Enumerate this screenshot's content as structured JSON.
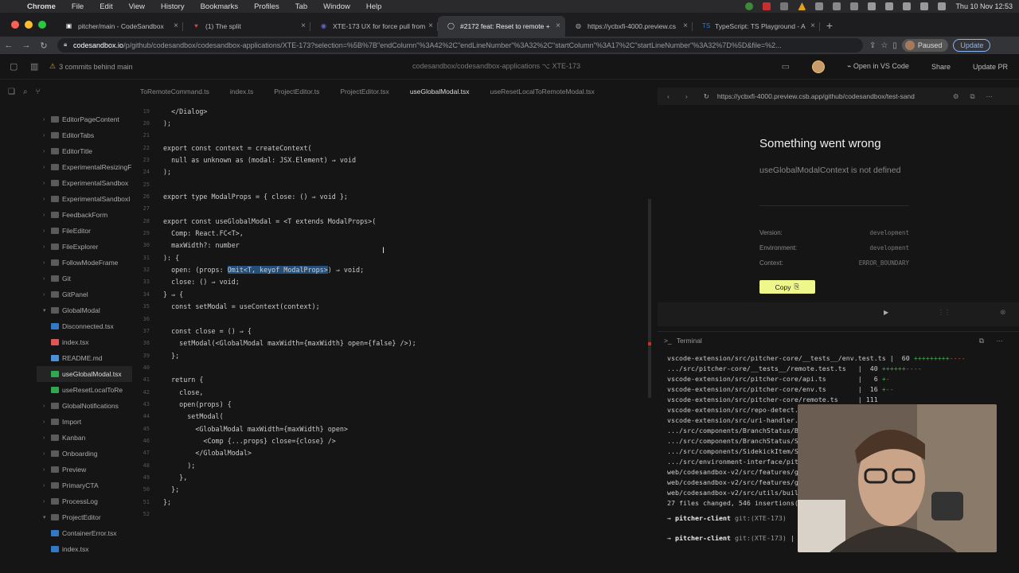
{
  "menubar": {
    "app": "Chrome",
    "items": [
      "File",
      "Edit",
      "View",
      "History",
      "Bookmarks",
      "Profiles",
      "Tab",
      "Window",
      "Help"
    ],
    "clock": "Thu 10 Nov  12:53"
  },
  "tabs": [
    {
      "label": "pitcher/main - CodeSandbox",
      "fav": "▣",
      "fav_color": "#ffffff"
    },
    {
      "label": "(1) The split",
      "fav": "♥",
      "fav_color": "#e04040"
    },
    {
      "label": "XTE-173 UX for force pull from",
      "fav": "◉",
      "fav_color": "#5e6ad2"
    },
    {
      "label": "#2172 feat: Reset to remote +",
      "fav": "◯",
      "fav_color": "#dddddd",
      "active": true
    },
    {
      "label": "https://ycbxfi-4000.preview.cs",
      "fav": "◍",
      "fav_color": "#aaaaaa"
    },
    {
      "label": "TypeScript: TS Playground - A",
      "fav": "TS",
      "fav_color": "#3178c6"
    }
  ],
  "address": {
    "host": "codesandbox.io",
    "path": "/p/github/codesandbox/codesandbox-applications/XTE-173?selection=%5B%7B\"endColumn\"%3A42%2C\"endLineNumber\"%3A32%2C\"startColumn\"%3A17%2C\"startLineNumber\"%3A32%7D%5D&file=%2...",
    "profile": "Paused",
    "update": "Update"
  },
  "csb": {
    "branch_status": "3 commits behind main",
    "repo": "codesandbox/codesandbox-applications",
    "branch_name": "XTE-173",
    "open_in": "Open in VS Code",
    "share": "Share",
    "update_pr": "Update PR"
  },
  "tree": [
    {
      "label": "EditorPageContent",
      "type": "folder"
    },
    {
      "label": "EditorTabs",
      "type": "folder"
    },
    {
      "label": "EditorTitle",
      "type": "folder"
    },
    {
      "label": "ExperimentalResizingF",
      "type": "folder"
    },
    {
      "label": "ExperimentalSandbox",
      "type": "folder"
    },
    {
      "label": "ExperimentalSandboxI",
      "type": "folder"
    },
    {
      "label": "FeedbackForm",
      "type": "folder"
    },
    {
      "label": "FileEditor",
      "type": "folder"
    },
    {
      "label": "FileExplorer",
      "type": "folder"
    },
    {
      "label": "FollowModeFrame",
      "type": "folder"
    },
    {
      "label": "Git",
      "type": "folder"
    },
    {
      "label": "GitPanel",
      "type": "folder"
    },
    {
      "label": "GlobalModal",
      "type": "folder-open"
    },
    {
      "label": "Disconnected.tsx",
      "type": "tsx",
      "indent": 1
    },
    {
      "label": "index.tsx",
      "type": "index",
      "indent": 1
    },
    {
      "label": "README.md",
      "type": "md",
      "indent": 1
    },
    {
      "label": "useGlobalModal.tsx",
      "type": "ts",
      "indent": 1,
      "selected": true
    },
    {
      "label": "useResetLocalToRe",
      "type": "ts",
      "indent": 1
    },
    {
      "label": "GlobalNotifications",
      "type": "folder"
    },
    {
      "label": "Import",
      "type": "folder"
    },
    {
      "label": "Kanban",
      "type": "folder"
    },
    {
      "label": "Onboarding",
      "type": "folder"
    },
    {
      "label": "Preview",
      "type": "folder"
    },
    {
      "label": "PrimaryCTA",
      "type": "folder"
    },
    {
      "label": "ProcessLog",
      "type": "folder"
    },
    {
      "label": "ProjectEditor",
      "type": "folder-open"
    },
    {
      "label": "ContainerError.tsx",
      "type": "tsx",
      "indent": 1
    },
    {
      "label": "index.tsx",
      "type": "tsx",
      "indent": 1
    }
  ],
  "editor_tabs": [
    {
      "label": "ToRemoteCommand.ts"
    },
    {
      "label": "index.ts"
    },
    {
      "label": "ProjectEditor.ts"
    },
    {
      "label": "ProjectEditor.tsx"
    },
    {
      "label": "useGlobalModal.tsx",
      "active": true
    },
    {
      "label": "useResetLocalToRemoteModal.tsx"
    }
  ],
  "code": [
    {
      "n": "19",
      "pre": "  </Dialog>",
      "sel": "",
      "post": ""
    },
    {
      "n": "20",
      "pre": ");",
      "sel": "",
      "post": ""
    },
    {
      "n": "21",
      "pre": "",
      "sel": "",
      "post": ""
    },
    {
      "n": "22",
      "pre": "export const context = createContext(",
      "sel": "",
      "post": ""
    },
    {
      "n": "23",
      "pre": "  null as unknown as (modal: JSX.Element) ⇒ void",
      "sel": "",
      "post": ""
    },
    {
      "n": "24",
      "pre": ");",
      "sel": "",
      "post": ""
    },
    {
      "n": "25",
      "pre": "",
      "sel": "",
      "post": ""
    },
    {
      "n": "26",
      "pre": "export type ModalProps = { close: () ⇒ void };",
      "sel": "",
      "post": ""
    },
    {
      "n": "27",
      "pre": "",
      "sel": "",
      "post": ""
    },
    {
      "n": "28",
      "pre": "export const useGlobalModal = <T extends ModalProps>(",
      "sel": "",
      "post": ""
    },
    {
      "n": "29",
      "pre": "  Comp: React.FC<T>,",
      "sel": "",
      "post": ""
    },
    {
      "n": "30",
      "pre": "  maxWidth?: number",
      "sel": "",
      "post": ""
    },
    {
      "n": "31",
      "pre": "): {",
      "sel": "",
      "post": ""
    },
    {
      "n": "32",
      "pre": "  open: (props: ",
      "sel": "Omit<T, keyof ModalProps>",
      "post": ") ⇒ void;"
    },
    {
      "n": "33",
      "pre": "  close: () ⇒ void;",
      "sel": "",
      "post": ""
    },
    {
      "n": "34",
      "pre": "} ⇒ {",
      "sel": "",
      "post": ""
    },
    {
      "n": "35",
      "pre": "  const setModal = useContext(context);",
      "sel": "",
      "post": ""
    },
    {
      "n": "36",
      "pre": "",
      "sel": "",
      "post": ""
    },
    {
      "n": "37",
      "pre": "  const close = () ⇒ {",
      "sel": "",
      "post": ""
    },
    {
      "n": "38",
      "pre": "    setModal(<GlobalModal maxWidth={maxWidth} open={false} />);",
      "sel": "",
      "post": ""
    },
    {
      "n": "39",
      "pre": "  };",
      "sel": "",
      "post": ""
    },
    {
      "n": "40",
      "pre": "",
      "sel": "",
      "post": ""
    },
    {
      "n": "41",
      "pre": "  return {",
      "sel": "",
      "post": ""
    },
    {
      "n": "42",
      "pre": "    close,",
      "sel": "",
      "post": ""
    },
    {
      "n": "43",
      "pre": "    open(props) {",
      "sel": "",
      "post": ""
    },
    {
      "n": "44",
      "pre": "      setModal(",
      "sel": "",
      "post": ""
    },
    {
      "n": "45",
      "pre": "        <GlobalModal maxWidth={maxWidth} open>",
      "sel": "",
      "post": ""
    },
    {
      "n": "46",
      "pre": "          <Comp {...props} close={close} />",
      "sel": "",
      "post": ""
    },
    {
      "n": "47",
      "pre": "        </GlobalModal>",
      "sel": "",
      "post": ""
    },
    {
      "n": "48",
      "pre": "      );",
      "sel": "",
      "post": ""
    },
    {
      "n": "49",
      "pre": "    },",
      "sel": "",
      "post": ""
    },
    {
      "n": "50",
      "pre": "  };",
      "sel": "",
      "post": ""
    },
    {
      "n": "51",
      "pre": "};",
      "sel": "",
      "post": ""
    },
    {
      "n": "52",
      "pre": "",
      "sel": "",
      "post": ""
    }
  ],
  "preview": {
    "url": "https://ycbxfi-4000.preview.csb.app/github/codesandbox/test-sand",
    "error_title": "Something went wrong",
    "error_message": "useGlobalModalContext is not defined",
    "details": [
      {
        "key": "Version:",
        "value": "development"
      },
      {
        "key": "Environment:",
        "value": "development"
      },
      {
        "key": "Context:",
        "value": "ERROR_BOUNDARY"
      }
    ],
    "copy": "Copy"
  },
  "terminal": {
    "title": "Terminal",
    "lines": [
      {
        "path": "vscode-extension/src/pitcher-core/__tests__/env.test.ts ",
        "count": "|  60 ",
        "plus": "+++++++++",
        "minus": "----"
      },
      {
        "path": ".../src/pitcher-core/__tests__/remote.test.ts   ",
        "count": "|  40 ",
        "plus": "++++++",
        "minus": "----"
      },
      {
        "path": "vscode-extension/src/pitcher-core/api.ts        ",
        "count": "|   6 ",
        "plus": "+",
        "minus": "-"
      },
      {
        "path": "vscode-extension/src/pitcher-core/env.ts        ",
        "count": "|  16 ",
        "plus": "+",
        "minus": "--"
      },
      {
        "path": "vscode-extension/src/pitcher-core/remote.ts     ",
        "count": "| 111 ",
        "plus": "",
        "minus": ""
      },
      {
        "path": "vscode-extension/src/repo-detect.",
        "count": "",
        "plus": "",
        "minus": ""
      },
      {
        "path": "vscode-extension/src/uri-handler.",
        "count": "",
        "plus": "",
        "minus": ""
      },
      {
        "path": ".../src/components/BranchStatus/B",
        "count": "",
        "plus": "",
        "minus": ""
      },
      {
        "path": ".../src/components/BranchStatus/S",
        "count": "",
        "plus": "",
        "minus": ""
      },
      {
        "path": ".../src/components/SidekickItem/S",
        "count": "",
        "plus": "",
        "minus": ""
      },
      {
        "path": ".../src/environment-interface/pit",
        "count": "",
        "plus": "",
        "minus": ""
      },
      {
        "path": "web/codesandbox-v2/src/features/g",
        "count": "",
        "plus": "",
        "minus": ""
      },
      {
        "path": "web/codesandbox-v2/src/features/g",
        "count": "",
        "plus": "",
        "minus": ""
      },
      {
        "path": "web/codesandbox-v2/src/utils/buil",
        "count": "",
        "plus": "",
        "minus": ""
      },
      {
        "path": "27 files changed, 546 insertions(",
        "count": "",
        "plus": "",
        "minus": ""
      }
    ],
    "prompt_dir": "pitcher-client",
    "prompt_git": "git:(XTE-173)"
  },
  "colors": {
    "selection": "#264f78",
    "copy_button": "#edf78a",
    "add": "#4caf50",
    "del": "#e05555"
  }
}
